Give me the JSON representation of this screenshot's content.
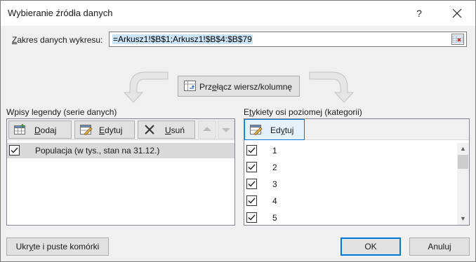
{
  "window": {
    "title": "Wybieranie źródła danych",
    "help_label": "?"
  },
  "range": {
    "label_prefix": "",
    "label_accel": "Z",
    "label_rest": "akres danych wykresu:",
    "value": "=Arkusz1!$B$1;Arkusz1!$B$4:$B$79"
  },
  "switch_button": {
    "label_pre": "Prz",
    "label_accel": "e",
    "label_post": "łącz wiersz/kolumnę"
  },
  "legend_panel": {
    "title": "Wpisy legendy (serie danych)",
    "add_pre": "",
    "add_accel": "D",
    "add_post": "odaj",
    "edit_pre": "",
    "edit_accel": "E",
    "edit_post": "dytuj",
    "remove_pre": "",
    "remove_accel": "U",
    "remove_post": "suń",
    "series": [
      {
        "label": "Populacja (w tys., stan na 31.12.)",
        "checked": true
      }
    ]
  },
  "category_panel": {
    "title_pre": "E",
    "title_accel": "t",
    "title_post": "ykiety osi poziomej (kategorii)",
    "edit_pre": "Ed",
    "edit_accel": "y",
    "edit_post": "tuj",
    "items": [
      {
        "label": "1",
        "checked": true
      },
      {
        "label": "2",
        "checked": true
      },
      {
        "label": "3",
        "checked": true
      },
      {
        "label": "4",
        "checked": true
      },
      {
        "label": "5",
        "checked": true
      }
    ]
  },
  "hidden_cells_button": {
    "label_pre": "Ukr",
    "label_accel": "y",
    "label_post": "te i puste komórki"
  },
  "ok_label": "OK",
  "cancel_label": "Anuluj",
  "colors": {
    "accent": "#0078d7",
    "selection": "#cce4f7",
    "selected_row": "#d9d9d9"
  }
}
